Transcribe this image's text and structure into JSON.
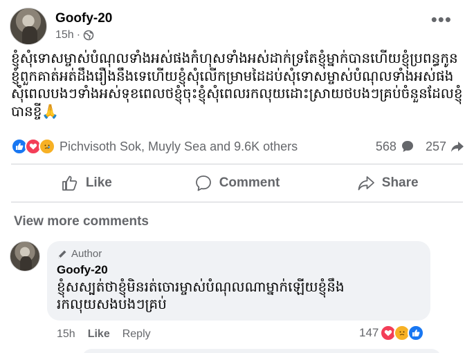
{
  "post": {
    "author": "Goofy-20",
    "time": "15h",
    "separator": "·",
    "text": "ខ្ញុំសុំទោសម្ចាស់បំណុលទាំងអស់ផងកំហុសទាំងអស់ដាក់ទ្រតែខ្ញុំម្នាក់បានហើយខ្ញុំប្រពន្ធកូនខ្ញុំពួកគាត់អត់ដឹងរឿងនឹងទេហើយខ្ញុំសុំលើកម្រាមដៃដប់សុំទោសម្ចាស់បំណុលទាំងអស់ផងសុំពេលបងៗទាំងអស់ទុខពេលថខ្ញុំចុះខ្ញុំសុំពេលរកលុយដោះស្រាយថបងៗគ្រប់ចំនួនដែលខ្ញុំបានខ្ចី🙏"
  },
  "reactions": {
    "names": "Pichvisoth Sok, Muyly Sea and 9.6K others",
    "comments_count": "568",
    "shares_count": "257"
  },
  "actions": {
    "like": "Like",
    "comment": "Comment",
    "share": "Share"
  },
  "view_more": "View more comments",
  "comment": {
    "badge": "Author",
    "name": "Goofy-20",
    "text": "ខ្ញុំសស្បត់ថាខ្ញុំមិនរត់ចោរម្ចាស់បំណុលណាម្នាក់ឡើយខ្ញុំនឹងរកលុយសងបងៗគ្រប់",
    "time": "15h",
    "like": "Like",
    "reply": "Reply",
    "reaction_count": "147"
  },
  "colors": {
    "like_blue": "#1877f2",
    "love_red": "#f33e58",
    "care_yellow": "#f7b125",
    "secondary_text": "#65676b",
    "bubble_bg": "#f0f2f5"
  }
}
